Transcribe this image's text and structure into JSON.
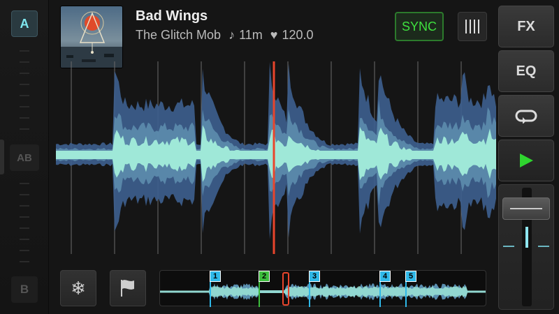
{
  "deck": {
    "a_label": "A",
    "ab_label": "AB",
    "b_label": "B"
  },
  "track": {
    "title": "Bad Wings",
    "artist": "The Glitch Mob",
    "duration": "11m",
    "bpm": "120.0"
  },
  "buttons": {
    "sync_label": "SYNC",
    "fx_label": "FX",
    "eq_label": "EQ"
  },
  "cues": [
    {
      "label": "1",
      "color": "#2fb8e8"
    },
    {
      "label": "2",
      "color": "#3dbd3d"
    },
    {
      "label": "3",
      "color": "#2fb8e8"
    },
    {
      "label": "4",
      "color": "#2fb8e8"
    },
    {
      "label": "5",
      "color": "#2fb8e8"
    }
  ],
  "colors": {
    "accent_cyan": "#7fe8f0",
    "sync_green": "#3fe03f",
    "playhead_red": "#e8452c",
    "waveform_dark": "#3d5f8f",
    "waveform_light": "#9fe8d8"
  }
}
